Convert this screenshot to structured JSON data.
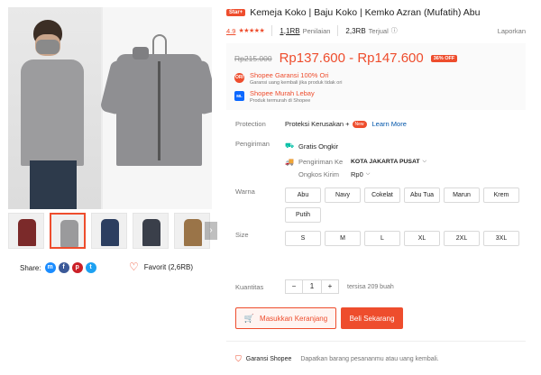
{
  "product": {
    "badge": "Star+",
    "title": "Kemeja Koko | Baju Koko | Kemko Azran (Mufatih) Abu",
    "rating": "4.9",
    "stars": "★★★★★",
    "rating_count": "1,1RB",
    "rating_label": "Penilaian",
    "sold_count": "2,3RB",
    "sold_label": "Terjual",
    "report_label": "Laporkan"
  },
  "price": {
    "original": "Rp215.000",
    "current": "Rp137.600 - Rp147.600",
    "discount": "36% OFF",
    "guarantees": [
      {
        "title": "Shopee Garansi 100% Ori",
        "subtitle": "Garansi uang kembali jika produk tidak ori",
        "icon": "ori-badge-icon",
        "color": "#ee4d2d"
      },
      {
        "title": "Shopee Murah Lebay",
        "subtitle": "Produk termurah di Shopee",
        "icon": "murah-lebay-icon",
        "color": "#0a68ff"
      }
    ]
  },
  "protection": {
    "label": "Protection",
    "text": "Proteksi Kerusakan +",
    "new_badge": "New",
    "link": "Learn More"
  },
  "shipping": {
    "label": "Pengiriman",
    "free": "Gratis Ongkir",
    "to_label": "Pengiriman Ke",
    "to_value": "KOTA JAKARTA PUSAT",
    "cost_label": "Ongkos Kirim",
    "cost_value": "Rp0"
  },
  "variants": {
    "label": "Warna",
    "options": [
      "Abu",
      "Navy",
      "Cokelat",
      "Abu Tua",
      "Marun",
      "Krem",
      "Putih"
    ]
  },
  "sizes": {
    "label": "Size",
    "options": [
      "S",
      "M",
      "L",
      "XL",
      "2XL",
      "3XL"
    ]
  },
  "quantity": {
    "label": "Kuantitas",
    "minus": "−",
    "value": "1",
    "plus": "+",
    "stock": "tersisa 209 buah"
  },
  "actions": {
    "cart": "Masukkan Keranjang",
    "buy": "Beli Sekarang"
  },
  "share": {
    "label": "Share:",
    "favorite": "Favorit (2,6RB)",
    "networks": [
      {
        "name": "messenger-icon",
        "glyph": "m",
        "color": "#1a8cff"
      },
      {
        "name": "facebook-icon",
        "glyph": "f",
        "color": "#3b5998"
      },
      {
        "name": "pinterest-icon",
        "glyph": "p",
        "color": "#cb2027"
      },
      {
        "name": "twitter-icon",
        "glyph": "t",
        "color": "#1da1f2"
      }
    ]
  },
  "footer": {
    "title": "Garansi Shopee",
    "desc": "Dapatkan barang pesananmu atau uang kembali."
  },
  "thumbnails": [
    {
      "color": "#7b2a2a"
    },
    {
      "color": "#9a9a9c"
    },
    {
      "color": "#2c3e60"
    },
    {
      "color": "#3a3f4a"
    },
    {
      "color": "#9a7448"
    },
    {
      "color": "#8a1c26"
    },
    {
      "color": "#e8dcc6"
    }
  ],
  "colors": {
    "accent": "#ee4d2d",
    "link": "#0055aa"
  }
}
